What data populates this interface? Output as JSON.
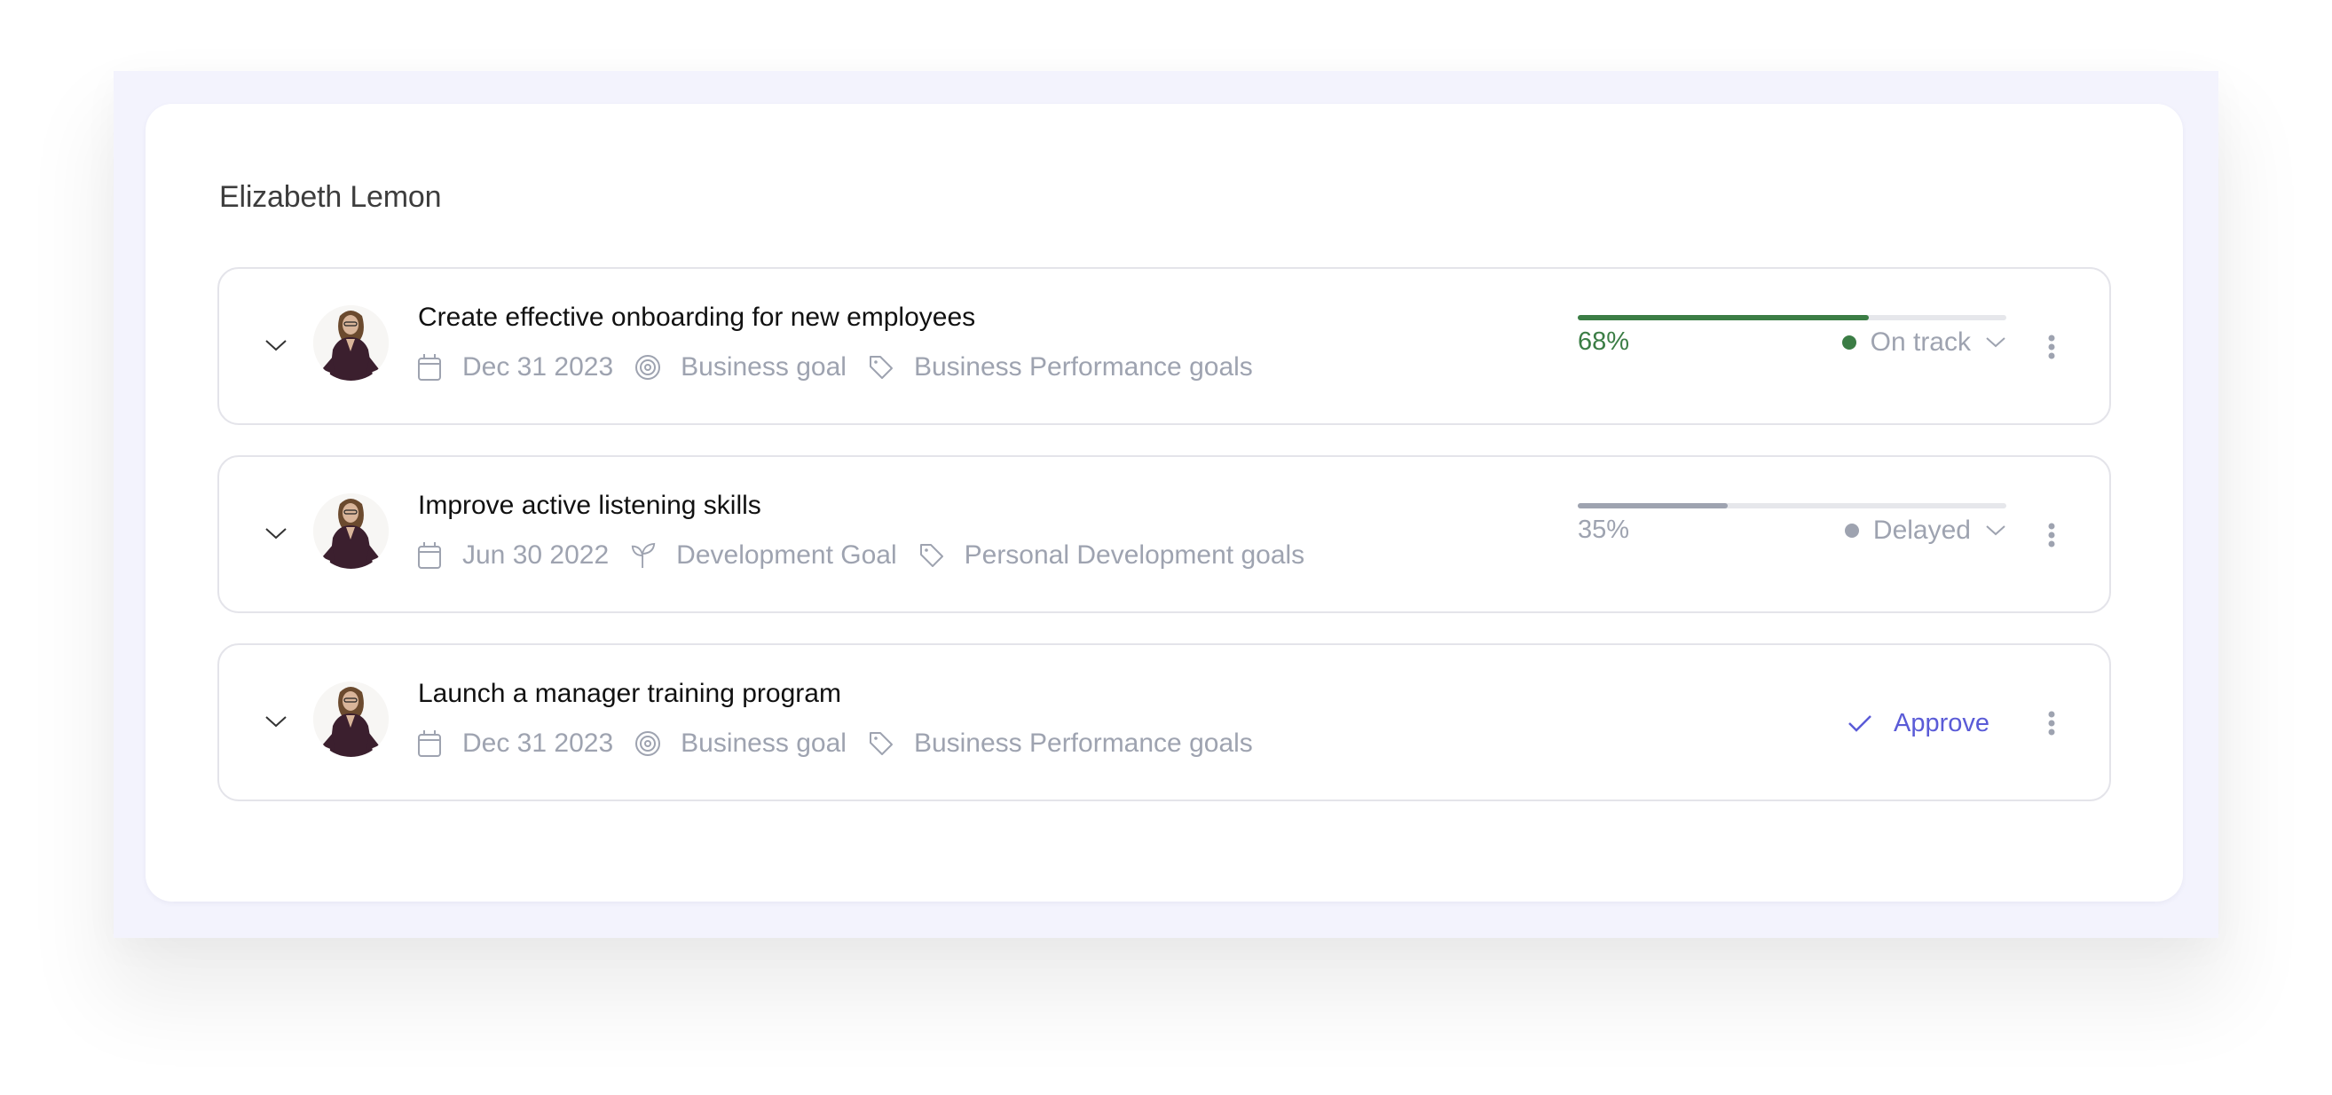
{
  "owner": {
    "name": "Elizabeth Lemon"
  },
  "goals": [
    {
      "title": "Create effective onboarding for new employees",
      "due_date": "Dec 31 2023",
      "type_icon": "target-icon",
      "type": "Business goal",
      "category": "Business Performance goals",
      "progress": {
        "percent": 68,
        "label": "68%",
        "color": "#3b7d45"
      },
      "status": {
        "label": "On track",
        "dot_color": "#3b7d45"
      }
    },
    {
      "title": "Improve active listening skills",
      "due_date": "Jun 30 2022",
      "type_icon": "sprout-icon",
      "type": "Development Goal",
      "category": "Personal Development goals",
      "progress": {
        "percent": 35,
        "label": "35%",
        "color": "#9ea3b0"
      },
      "status": {
        "label": "Delayed",
        "dot_color": "#9ea3b0"
      }
    },
    {
      "title": "Launch a manager training program",
      "due_date": "Dec 31 2023",
      "type_icon": "target-icon",
      "type": "Business goal",
      "category": "Business Performance goals",
      "action": {
        "label": "Approve",
        "icon": "check-icon",
        "color": "#5a5bd7"
      }
    }
  ],
  "colors": {
    "backdrop": "#f3f3fd",
    "row_border": "#e4e4ea",
    "meta_text": "#9ea3b0",
    "title_text": "#111111"
  }
}
